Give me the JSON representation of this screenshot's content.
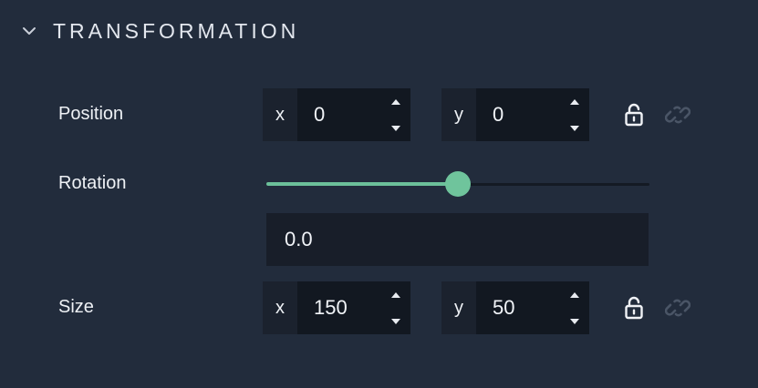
{
  "section": {
    "title": "TRANSFORMATION",
    "expanded": true,
    "collapse_icon": "chevron-down-icon"
  },
  "position": {
    "label": "Position",
    "x": {
      "axis": "x",
      "value": "0"
    },
    "y": {
      "axis": "y",
      "value": "0"
    },
    "lock_icon": "lock-open-icon",
    "link_icon": "link-icon"
  },
  "rotation": {
    "label": "Rotation",
    "value": "0.0",
    "slider_fraction": 0.5
  },
  "size": {
    "label": "Size",
    "x": {
      "axis": "x",
      "value": "150"
    },
    "y": {
      "axis": "y",
      "value": "50"
    },
    "lock_icon": "lock-open-icon",
    "link_icon": "link-icon"
  },
  "colors": {
    "background": "#222c3c",
    "accent": "#6fc49c",
    "input_bg": "#121821",
    "link_icon_muted": "#4a5566"
  }
}
